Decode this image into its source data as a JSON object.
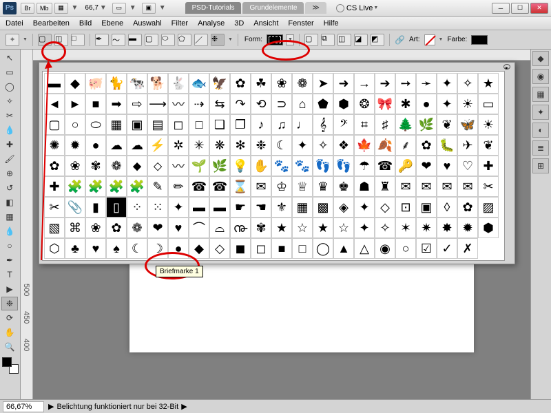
{
  "title": {
    "ps": "Ps",
    "br": "Br",
    "mb": "Mb",
    "zoom_title": "66,7",
    "tab1": "PSD-Tutorials",
    "tab2": "Grundelemente",
    "cslive": "CS Live"
  },
  "menu": [
    "Datei",
    "Bearbeiten",
    "Bild",
    "Ebene",
    "Auswahl",
    "Filter",
    "Analyse",
    "3D",
    "Ansicht",
    "Fenster",
    "Hilfe"
  ],
  "optbar": {
    "form": "Form:",
    "art": "Art:",
    "farbe": "Farbe:"
  },
  "tooltip": "Briefmarke 1",
  "status": {
    "zoom": "66,67%",
    "msg": "Belichtung funktioniert nur bei 32-Bit"
  },
  "ruler_marks": [
    "500",
    "450",
    "400"
  ],
  "shapes": [
    "▬",
    "◆",
    "🐖",
    "🐈",
    "🐄",
    "🐕",
    "🐇",
    "🐟",
    "🦅",
    "✿",
    "☘",
    "❀",
    "❁",
    "➤",
    "➜",
    "→",
    "➔",
    "➙",
    "➛",
    "✦",
    "✧",
    "★",
    "◄",
    "►",
    "■",
    "➡",
    "⇨",
    "⟶",
    "〰",
    "⇢",
    "⇆",
    "↷",
    "⟲",
    "⊃",
    "⌂",
    "⬟",
    "⬢",
    "❂",
    "🎀",
    "✱",
    "●",
    "✦",
    "☀",
    "▭",
    "▢",
    "○",
    "⬭",
    "▦",
    "▣",
    "▤",
    "◻",
    "□",
    "❏",
    "❐",
    "♪",
    "♫",
    "♩",
    "𝄞",
    "𝄢",
    "⌗",
    "♯",
    "🌲",
    "🌿",
    "❦",
    "🦋",
    "☀",
    "✺",
    "✹",
    "●",
    "☁",
    "☁",
    "⚡",
    "✲",
    "✳",
    "❋",
    "✻",
    "❉",
    "☾",
    "✦",
    "✧",
    "❖",
    "🍁",
    "🍂",
    "⸙",
    "✿",
    "🐛",
    "✈",
    "❦",
    "✿",
    "❀",
    "✾",
    "❁",
    "⬥",
    "⬦",
    "〰",
    "🌱",
    "🌿",
    "💡",
    "✋",
    "🐾",
    "🐾",
    "👣",
    "👣",
    "☂",
    "☎",
    "🔑",
    "❤",
    "♥",
    "♡",
    "✚",
    "✚",
    "🧩",
    "🧩",
    "🧩",
    "🧩",
    "✎",
    "✏",
    "☎",
    "☎",
    "⌛",
    "✉",
    "♔",
    "♕",
    "♛",
    "♚",
    "☗",
    "♜",
    "✉",
    "✉",
    "✉",
    "✉",
    "✂",
    "✂",
    "📎",
    "▮",
    "▯",
    "⁘",
    "⁙",
    "✦",
    "▬",
    "▬",
    "☛",
    "☚",
    "⚜",
    "▦",
    "▩",
    "◈",
    "✦",
    "◇",
    "⊡",
    "▣",
    "◊",
    "✿",
    "▨",
    "▧",
    "⌘",
    "❀",
    "✿",
    "❁",
    "❤",
    "♥",
    "⌒",
    "⌓",
    "൹",
    "✾",
    "★",
    "☆",
    "★",
    "☆",
    "✦",
    "✧",
    "✶",
    "✷",
    "✸",
    "✹",
    "⬢",
    "⬡",
    "♣",
    "♥",
    "♠",
    "☾",
    "☽",
    "●",
    "◆",
    "◇",
    "◼",
    "◻",
    "■",
    "□",
    "◯",
    "▲",
    "△",
    "◉",
    "○",
    "☑",
    "✓",
    "✗"
  ]
}
